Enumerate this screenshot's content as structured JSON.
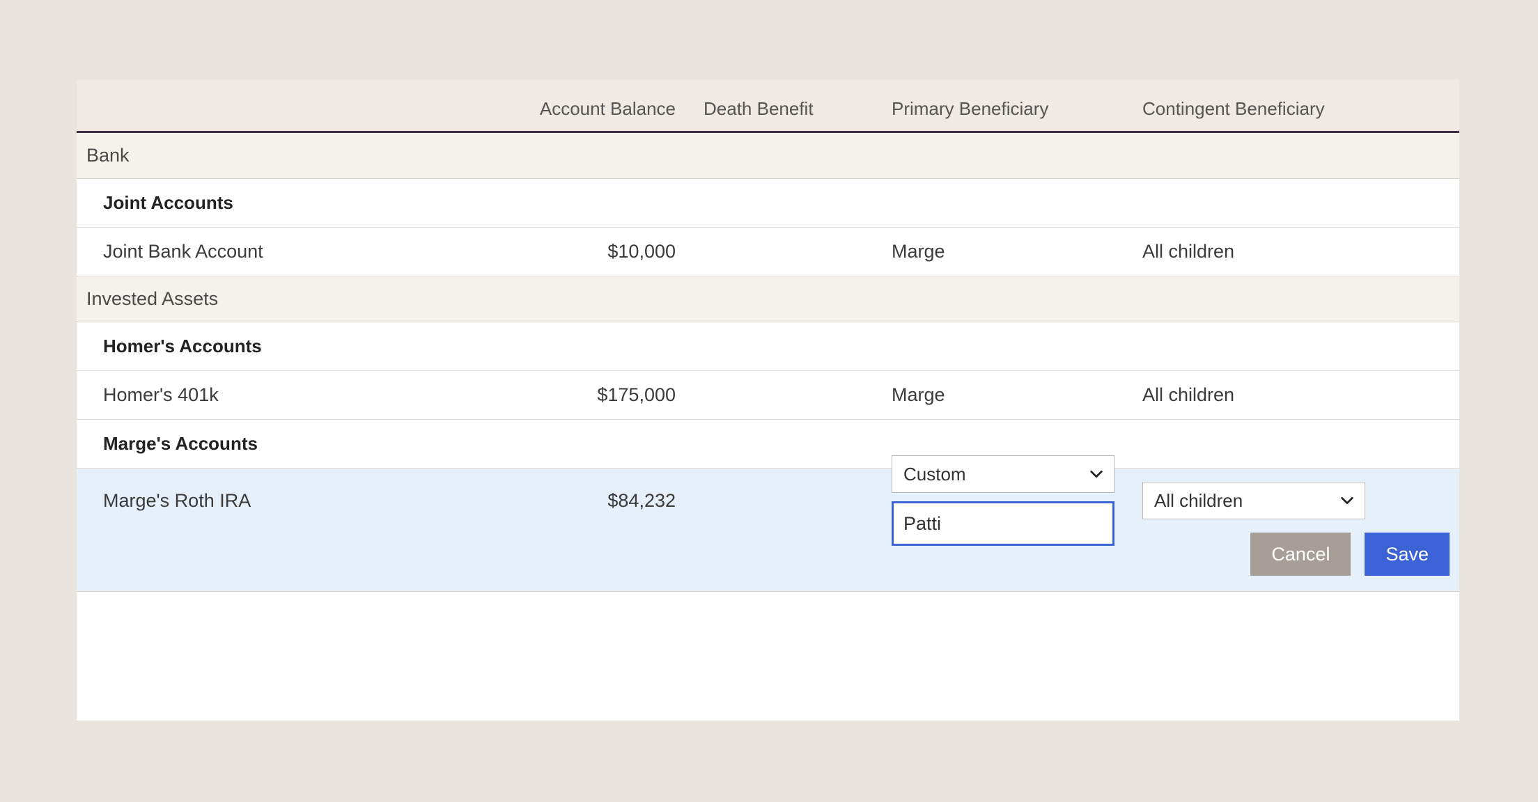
{
  "headers": {
    "balance": "Account Balance",
    "death": "Death Benefit",
    "primary": "Primary Beneficiary",
    "contingent": "Contingent Beneficiary"
  },
  "categories": {
    "bank": "Bank",
    "invested": "Invested Assets"
  },
  "subcats": {
    "joint": "Joint Accounts",
    "homer": "Homer's Accounts",
    "marge": "Marge's Accounts"
  },
  "accounts": {
    "jointBank": {
      "name": "Joint Bank Account",
      "balance": "$10,000",
      "primary": "Marge",
      "contingent": "All children"
    },
    "homer401k": {
      "name": "Homer's 401k",
      "balance": "$175,000",
      "primary": "Marge",
      "contingent": "All children"
    },
    "margeRoth": {
      "name": "Marge's Roth IRA",
      "balance": "$84,232",
      "primarySelect": "Custom",
      "primaryInput": "Patti",
      "contingentSelect": "All children"
    }
  },
  "buttons": {
    "cancel": "Cancel",
    "save": "Save"
  }
}
